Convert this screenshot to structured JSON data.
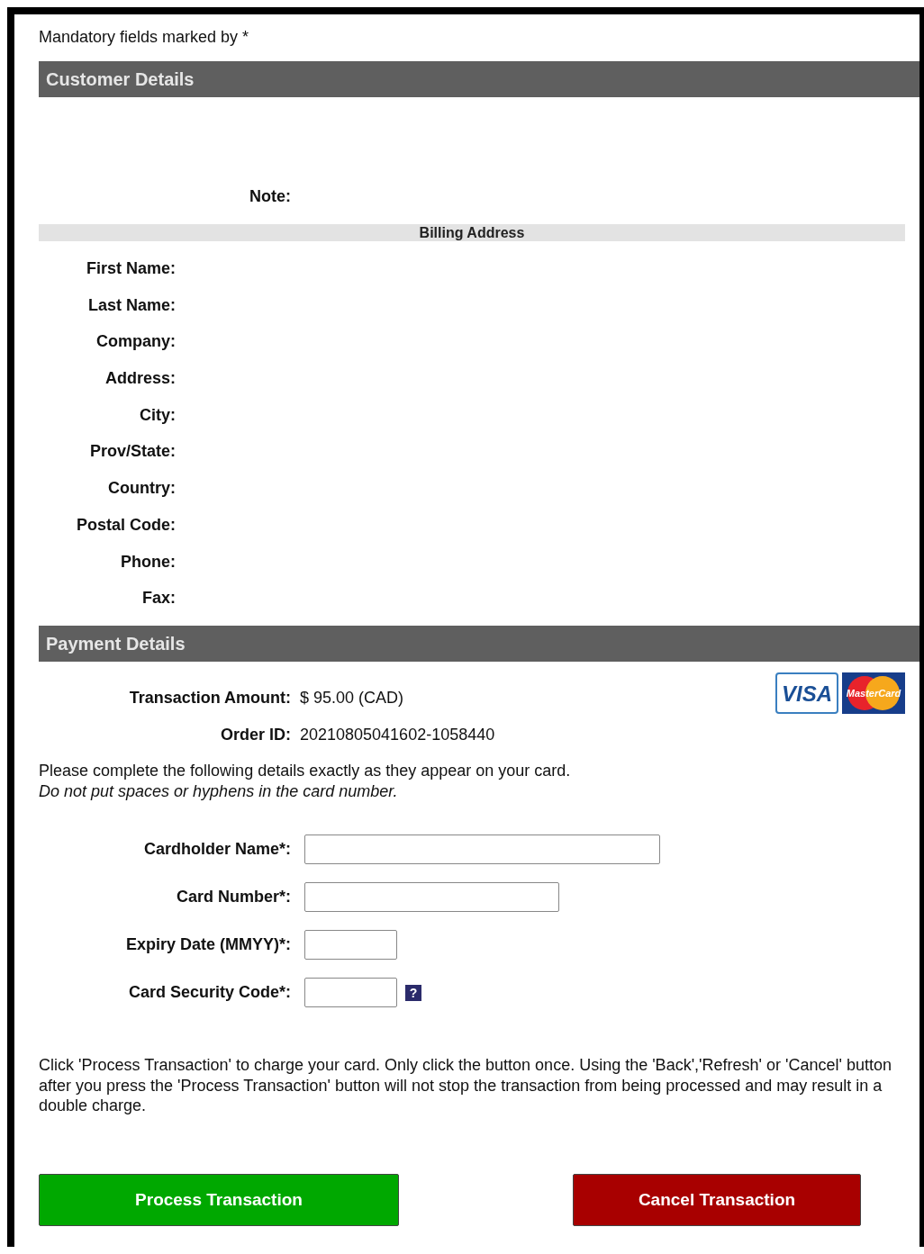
{
  "mandatory_note": "Mandatory fields marked by *",
  "customer_section": {
    "title": "Customer Details",
    "note_label": "Note:",
    "billing_title": "Billing Address",
    "fields": [
      "First Name:",
      "Last Name:",
      "Company:",
      "Address:",
      "City:",
      "Prov/State:",
      "Country:",
      "Postal Code:",
      "Phone:",
      "Fax:"
    ]
  },
  "payment_section": {
    "title": "Payment Details",
    "summary": [
      {
        "label": "Transaction Amount:",
        "value": "$ 95.00 (CAD)"
      },
      {
        "label": "Order ID:",
        "value": "20210805041602-1058440"
      }
    ],
    "card_logos": [
      {
        "kind": "visa",
        "label": "VISA"
      },
      {
        "kind": "mastercard",
        "label": "MasterCard"
      }
    ],
    "instructions": "Please complete the following details exactly as they appear on your card.",
    "instructions_note": "Do not put spaces or hyphens in the card number.",
    "inputs": [
      {
        "label": "Cardholder Name*:",
        "kind": "wide"
      },
      {
        "label": "Card Number*:",
        "kind": "medium"
      },
      {
        "label": "Expiry Date (MMYY)*:",
        "kind": "short"
      },
      {
        "label": "Card Security Code*:",
        "kind": "short",
        "help": "?"
      }
    ]
  },
  "disclaimer": "Click 'Process Transaction' to charge your card. Only click the button once. Using the 'Back','Refresh' or 'Cancel' button after you press the 'Process Transaction' button will not stop the transaction from being processed and may result in a double charge.",
  "buttons": [
    {
      "label": "Process Transaction",
      "kind": "process"
    },
    {
      "label": "Cancel Transaction",
      "kind": "cancel"
    }
  ]
}
